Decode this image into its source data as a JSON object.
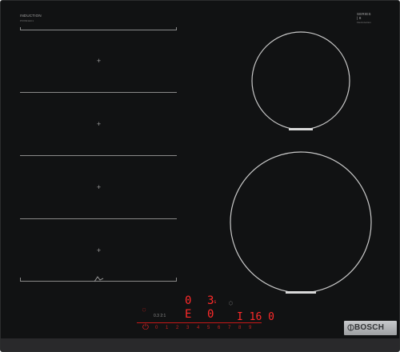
{
  "header": {
    "left_title": "INDUCTION",
    "left_sub": "PXX631HC1",
    "right_title_1": "SERIES",
    "right_title_2": "| 8",
    "right_sub": "FlexInduction"
  },
  "flex_zone": {
    "zone_plus": "+"
  },
  "controls": {
    "power_icon": "⏻",
    "status_left": "0",
    "status_right": "3",
    "status_right_sub": "s",
    "flex_left": "E",
    "flex_right": "0",
    "timer_icon": "◌",
    "timer_value": "I 16 0",
    "status_bar_icon": "◌",
    "scale": [
      "0",
      "1",
      "2",
      "3",
      "4",
      "5",
      "6",
      "7",
      "8",
      "9"
    ],
    "tiny_label": "0.3 2:1"
  },
  "brand": {
    "logo_text": "BOSCH"
  },
  "colors": {
    "surface": "#111213",
    "led": "#ff2a2a",
    "marking": "#8a8a8a",
    "plate": "#b5b7ba"
  }
}
